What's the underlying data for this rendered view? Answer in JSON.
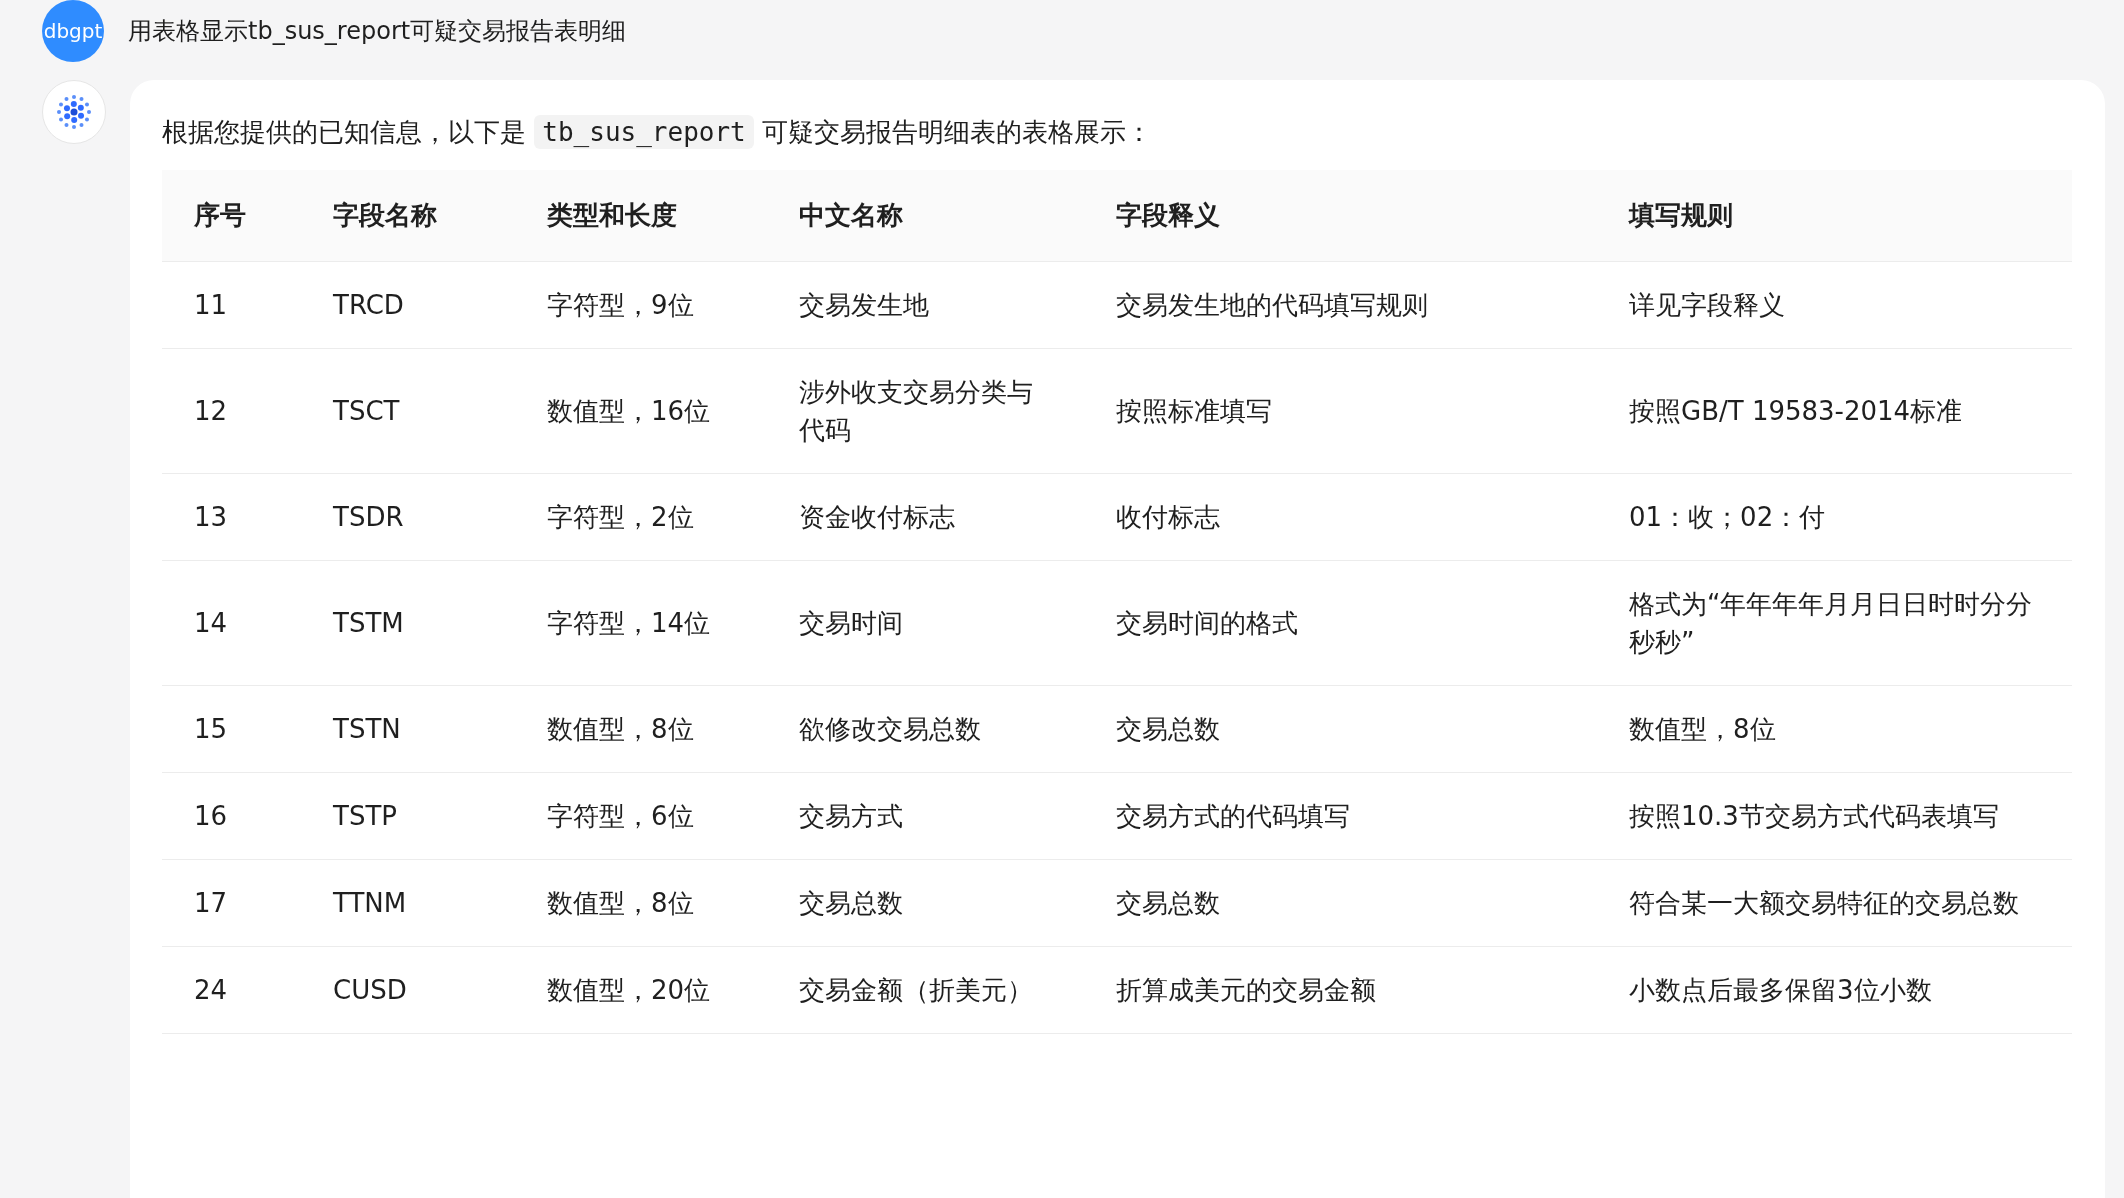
{
  "user_message": {
    "avatar_label": "dbgpt",
    "text": "用表格显示tb_sus_report可疑交易报告表明细"
  },
  "reply": {
    "intro": [
      {
        "kind": "text",
        "text": "根据您提供的已知信息，以下是 "
      },
      {
        "kind": "code",
        "text": "tb_sus_report"
      },
      {
        "kind": "text",
        "text": " 可疑交易报告明细表的表格展示："
      }
    ],
    "table": {
      "columns": [
        "序号",
        "字段名称",
        "类型和长度",
        "中文名称",
        "字段释义",
        "填写规则"
      ],
      "rows": [
        [
          "11",
          "TRCD",
          "字符型，9位",
          "交易发生地",
          "交易发生地的代码填写规则",
          "详见字段释义"
        ],
        [
          "12",
          "TSCT",
          "数值型，16位",
          "涉外收支交易分类与代码",
          "按照标准填写",
          "按照GB/T 19583-2014标准"
        ],
        [
          "13",
          "TSDR",
          "字符型，2位",
          "资金收付标志",
          "收付标志",
          "01：收；02：付"
        ],
        [
          "14",
          "TSTM",
          "字符型，14位",
          "交易时间",
          "交易时间的格式",
          "格式为“年年年年月月日日时时分分秒秒”"
        ],
        [
          "15",
          "TSTN",
          "数值型，8位",
          "欲修改交易总数",
          "交易总数",
          "数值型，8位"
        ],
        [
          "16",
          "TSTP",
          "字符型，6位",
          "交易方式",
          "交易方式的代码填写",
          "按照10.3节交易方式代码表填写"
        ],
        [
          "17",
          "TTNM",
          "数值型，8位",
          "交易总数",
          "交易总数",
          "符合某一大额交易特征的交易总数"
        ],
        [
          "24",
          "CUSD",
          "数值型，20位",
          "交易金额（折美元）",
          "折算成美元的交易金额",
          "小数点后最多保留3位小数"
        ]
      ]
    }
  }
}
